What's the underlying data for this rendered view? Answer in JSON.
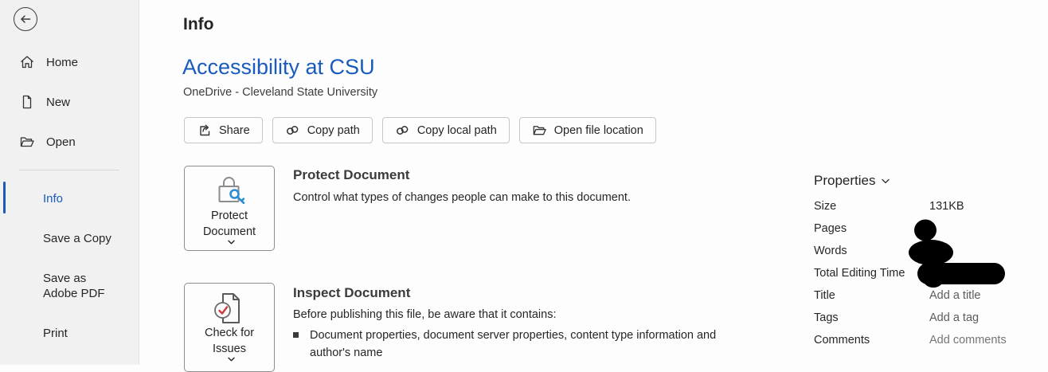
{
  "colors": {
    "accent_blue": "#185abd",
    "key_blue": "#2b8ed5",
    "check_red": "#cf3a3a",
    "redaction": "#000000"
  },
  "icons": {
    "back": "arrow-left-circle",
    "home": "house",
    "new": "blank-page",
    "open": "folder-open",
    "share": "share-arrow",
    "copy_path": "chain-link",
    "copy_local_path": "chain-link",
    "open_file_location": "folder-open",
    "protect_tile": "lock-with-key",
    "inspect_tile": "document-with-checkmark",
    "chevron": "chevron-down"
  },
  "sidebar": {
    "nav_items": [
      {
        "label": "Home"
      },
      {
        "label": "New"
      },
      {
        "label": "Open"
      }
    ],
    "file_items": [
      {
        "label": "Info",
        "selected": true
      },
      {
        "label": "Save a Copy",
        "selected": false
      },
      {
        "label": "Save as Adobe PDF",
        "selected": false
      },
      {
        "label": "Print",
        "selected": false
      }
    ]
  },
  "main": {
    "page_title": "Info",
    "document_title": "Accessibility at CSU",
    "document_location": "OneDrive - Cleveland State University",
    "actions": [
      {
        "label": "Share"
      },
      {
        "label": "Copy path"
      },
      {
        "label": "Copy local path"
      },
      {
        "label": "Open file location"
      }
    ],
    "protect": {
      "tile_label": "Protect Document",
      "heading": "Protect Document",
      "description": "Control what types of changes people can make to this document."
    },
    "inspect": {
      "tile_label": "Check for Issues",
      "heading": "Inspect Document",
      "intro": "Before publishing this file, be aware that it contains:",
      "bullet": "Document properties, document server properties, content type information and author's name"
    }
  },
  "properties": {
    "header": "Properties",
    "rows": [
      {
        "label": "Size",
        "value": "131KB",
        "redacted": false
      },
      {
        "label": "Pages",
        "value": "",
        "redacted": true
      },
      {
        "label": "Words",
        "value": "",
        "redacted": true
      },
      {
        "label": "Total Editing Time",
        "value": "",
        "redacted": true
      },
      {
        "label": "Title",
        "value": "Add a title",
        "placeholder": true
      },
      {
        "label": "Tags",
        "value": "Add a tag",
        "placeholder": true
      },
      {
        "label": "Comments",
        "value": "Add comments",
        "placeholder": true
      }
    ]
  }
}
